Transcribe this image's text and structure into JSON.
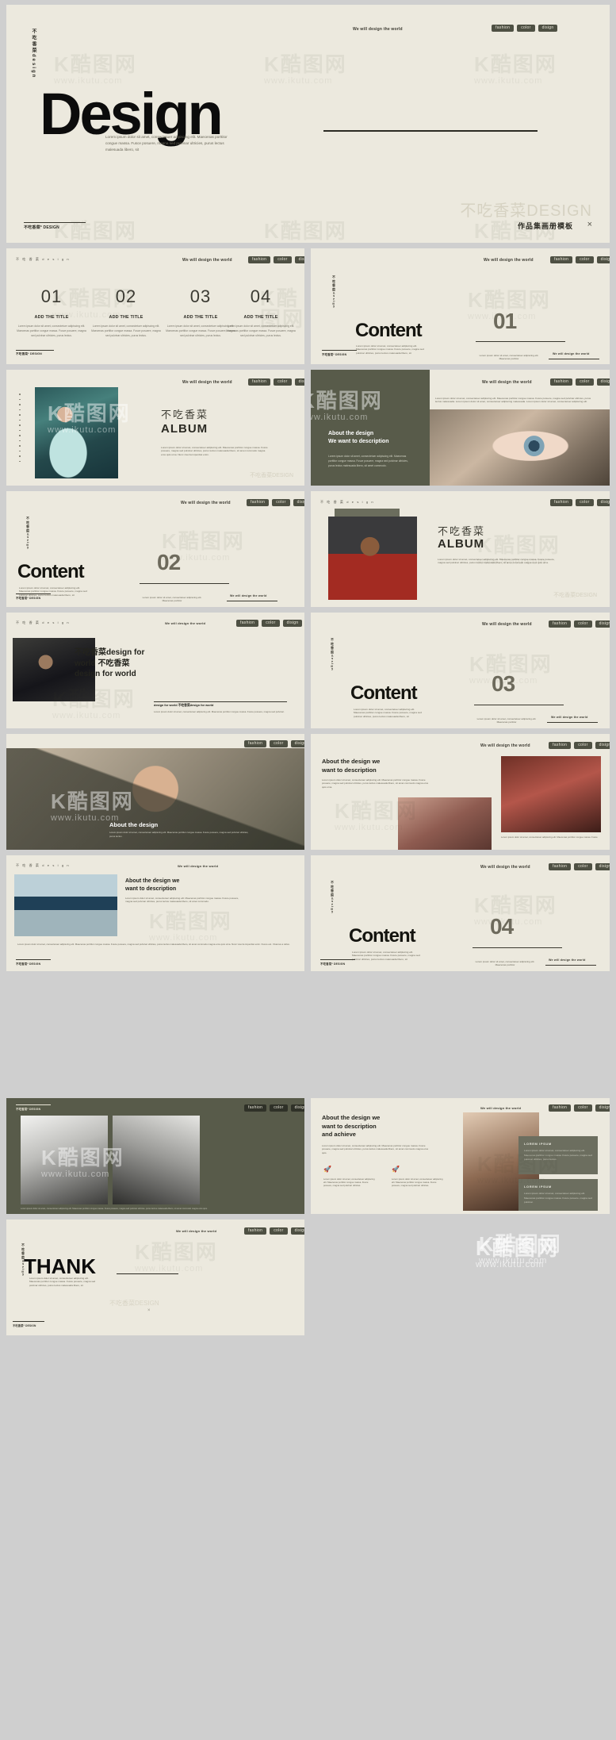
{
  "brand": {
    "vertical_label": "不吃香菜design",
    "tiny_label": "不 吃 香 菜 d e s i g n",
    "logo_text": "不吃香菜* DESIGN",
    "watermark_big": "不吃香菜DESIGN",
    "watermark_k": "K酷图网",
    "watermark_url": "www.ikutu.com"
  },
  "header": {
    "slogan": "We will design the world",
    "tags": [
      "fashion",
      "color",
      "disign"
    ]
  },
  "hero": {
    "title": "Design",
    "lorem": "Lorem ipsum dolor sit amet, consectetuer adipiscing elit. Maecenas porttitor congue massa. Fusce posuere, magna sed pulvinar ultricies, purus lectus malesuada libero, sit",
    "brand_watermark": "不吃香菜DESIGN",
    "caption": "作品集画册模板",
    "close_icon": "×"
  },
  "slides": {
    "numbers": {
      "items": [
        {
          "number": "01",
          "title": "ADD THE TITLE",
          "desc": "Lorem ipsum dolor sit amet, consectetuer adipiscing elit. Maecenas porttitor congue massa. Fusce posuere, magna sed pulvinar ultricies, purus lectus."
        },
        {
          "number": "02",
          "title": "ADD THE TITLE",
          "desc": "Lorem ipsum dolor sit amet, consectetuer adipiscing elit. Maecenas porttitor congue massa. Fusce posuere, magna sed pulvinar ultricies, purus lectus."
        },
        {
          "number": "03",
          "title": "ADD THE TITLE",
          "desc": "Lorem ipsum dolor sit amet, consectetuer adipiscing elit. Maecenas porttitor congue massa. Fusce posuere, magna sed pulvinar ultricies, purus lectus."
        },
        {
          "number": "04",
          "title": "ADD THE TITLE",
          "desc": "Lorem ipsum dolor sit amet, consectetuer adipiscing elit. Maecenas porttitor congue massa. Fusce posuere, magna sed pulvinar ultricies, purus lectus."
        }
      ]
    },
    "content01": {
      "word": "Content",
      "number": "01",
      "lorem_left": "Lorem ipsum dolor sit amet, consectetuer adipiscing elit. Maecenas porttitor congue massa. Fusce posuere, magna sed pulvinar ultricies, purus lectus malesuada libero, sit",
      "lorem_right": "Lorem ipsum dolor sit amet, consectetuer adipiscing elit. Maecenas porttitor",
      "slogan": "We will design the world"
    },
    "album": {
      "cn_title": "不吃香菜",
      "en_title": "ALBUM",
      "lorem": "Lorem ipsum dolor sit amet, consectetuer adipiscing elit. Maecenas porttitor congue massa. Fusce posuere, magna sed pulvinar ultricies, purus lectus malesuada libero, sit amet commodo magna eros quis urna. Nunc viverra imperdiet enim.",
      "brand_watermark": "不吃香菜DESIGN"
    },
    "about1": {
      "heading_line1": "About the design",
      "heading_line2": "We want to description",
      "body": "Lorem ipsum dolor sit amet, consectetuer adipiscing elit. Maecenas porttitor congue massa. Fusce posuere, magna sed pulvinar ultricies, purus lectus malesuada libero, sit amet commodo.",
      "top_text": "Lorem ipsum dolor sit amet, consectetuer adipiscing elit. Maecenas porttitor congue massa. Fusce posuere, magna sed pulvinar ultricies, purus lectus malesuada. Lorem ipsum dolor sit amet, consectetuer adipiscing malesuada. Lorem ipsum dolor sit amet, consectetuer adipiscing elit."
    },
    "content02": {
      "word": "Content",
      "number": "02",
      "lorem_left": "Lorem ipsum dolor sit amet, consectetuer adipiscing elit. Maecenas porttitor congue massa. Fusce posuere, magna sed pulvinar ultricies, purus lectus malesuada libero, sit",
      "lorem_right": "Lorem ipsum dolor sit amet, consectetuer adipiscing elit. Maecenas porttitor",
      "slogan": "We will design the world"
    },
    "album2": {
      "cn_title": "不吃香菜",
      "en_title": "ALBUM",
      "lorem": "Lorem ipsum dolor sit amet, consectetuer adipiscing elit. Maecenas porttitor congue massa. Fusce posuere, magna sed pulvinar ultricies, purus lectus malesuada libero, sit amet commodo magna eros quis urna."
    },
    "designforworld": {
      "line1": "不吃香菜design for",
      "line2": "world 不吃香菜",
      "line3": "design for world",
      "footer_title": "design for world 不吃香菜design for world",
      "footer_body": "Lorem ipsum dolor sit amet, consectetuer adipiscing elit. Maecenas porttitor congue massa. Fusce posuere, magna sed pulvinar."
    },
    "content03": {
      "word": "Content",
      "number": "03",
      "lorem_left": "Lorem ipsum dolor sit amet, consectetuer adipiscing elit. Maecenas porttitor congue massa. Fusce posuere, magna sed pulvinar ultricies, purus lectus malesuada libero, sit",
      "lorem_right": "Lorem ipsum dolor sit amet, consectetuer adipiscing elit. Maecenas porttitor",
      "slogan": "We will design the world"
    },
    "about_glass": {
      "heading": "About the design",
      "body": "Lorem ipsum dolor sit amet, consectetuer adipiscing elit. Maecenas porttitor congue massa. Fusce posuere, magna sed pulvinar ultricies, purus lectus."
    },
    "about2": {
      "heading_line1": "About the design we",
      "heading_line2": "want to description",
      "body": "Lorem ipsum dolor sit amet, consectetuer adipiscing elit. Maecenas porttitor congue massa. Fusce posuere, magna sed pulvinar ultricies, purus lectus malesuada libero, sit amet commodo magna eros quis urna.",
      "caption": "Lorem ipsum dolor sit amet, consectetuer adipiscing elit. Maecenas porttitor congue massa. Fusce"
    },
    "bridge": {
      "heading_line1": "About the design we",
      "heading_line2": "want to description",
      "body": "Lorem ipsum dolor sit amet, consectetuer adipiscing elit. Maecenas porttitor congue massa. Fusce posuere, magna sed pulvinar ultricies, purus lectus malesuada libero, sit amet commodo.",
      "bottom_text": "Lorem ipsum dolor sit amet, consectetuer adipiscing elit. Maecenas porttitor congue massa. Fusce posuere, magna sed pulvinar ultricies, purus lectus malesuada libero, sit amet commodo magna eros quis urna. Nunc viverra imperdiet enim. Fusce est. Vivamus a tellus."
    },
    "content04": {
      "word": "Content",
      "number": "04",
      "lorem_left": "Lorem ipsum dolor sit amet, consectetuer adipiscing elit. Maecenas porttitor congue massa. Fusce posuere, magna sed pulvinar ultricies, purus lectus malesuada libero, sit",
      "lorem_right": "Lorem ipsum dolor sit amet, consectetuer adipiscing elit. Maecenas porttitor",
      "slogan": "We will design the world"
    },
    "achieve": {
      "heading_line1": "About the design we",
      "heading_line2": "want to description",
      "heading_line3": "and achieve",
      "body": "Lorem ipsum dolor sit amet, consectetuer adipiscing elit. Maecenas porttitor congue massa. Fusce posuere, magna sed pulvinar ultricies, purus lectus malesuada libero, sit amet commodo magna eros quis.",
      "features": [
        {
          "icon": "rocket-icon",
          "text": "Lorem ipsum dolor sit amet, consectetuer adipiscing elit. Maecenas porttitor congue massa. Fusce posuere, magna sed pulvinar ultricies."
        },
        {
          "icon": "rocket-icon",
          "text": "Lorem ipsum dolor sit amet, consectetuer adipiscing elit. Maecenas porttitor congue massa. Fusce posuere, magna sed pulvinar ultricies."
        }
      ],
      "cards": [
        {
          "title": "LOREM IPSUM",
          "text": "Lorem ipsum dolor sit amet, consectetuer adipiscing elit. Maecenas porttitor congue massa. Fusce posuere, magna sed pulvinar ultricies, purus lectus."
        },
        {
          "title": "LOREM IPSUM",
          "text": "Lorem ipsum dolor sit amet, consectetuer adipiscing elit. Maecenas porttitor congue massa. Fusce posuere, magna sed pulvinar."
        }
      ]
    },
    "thank": {
      "word": "THANK",
      "lorem": "Lorem ipsum dolor sit amet, consectetuer adipiscing elit. Maecenas porttitor congue massa. Fusce posuere, magna sed pulvinar ultricies, purus lectus malesuada libero, sit",
      "brand_watermark": "不吃香菜DESIGN",
      "close_icon": "×"
    }
  },
  "colors": {
    "background": "#ece9de",
    "dark_panel": "#585b4a",
    "tag_bg": "#4e5043",
    "text": "#2d2c25",
    "page_gray": "#cfcfcf"
  }
}
